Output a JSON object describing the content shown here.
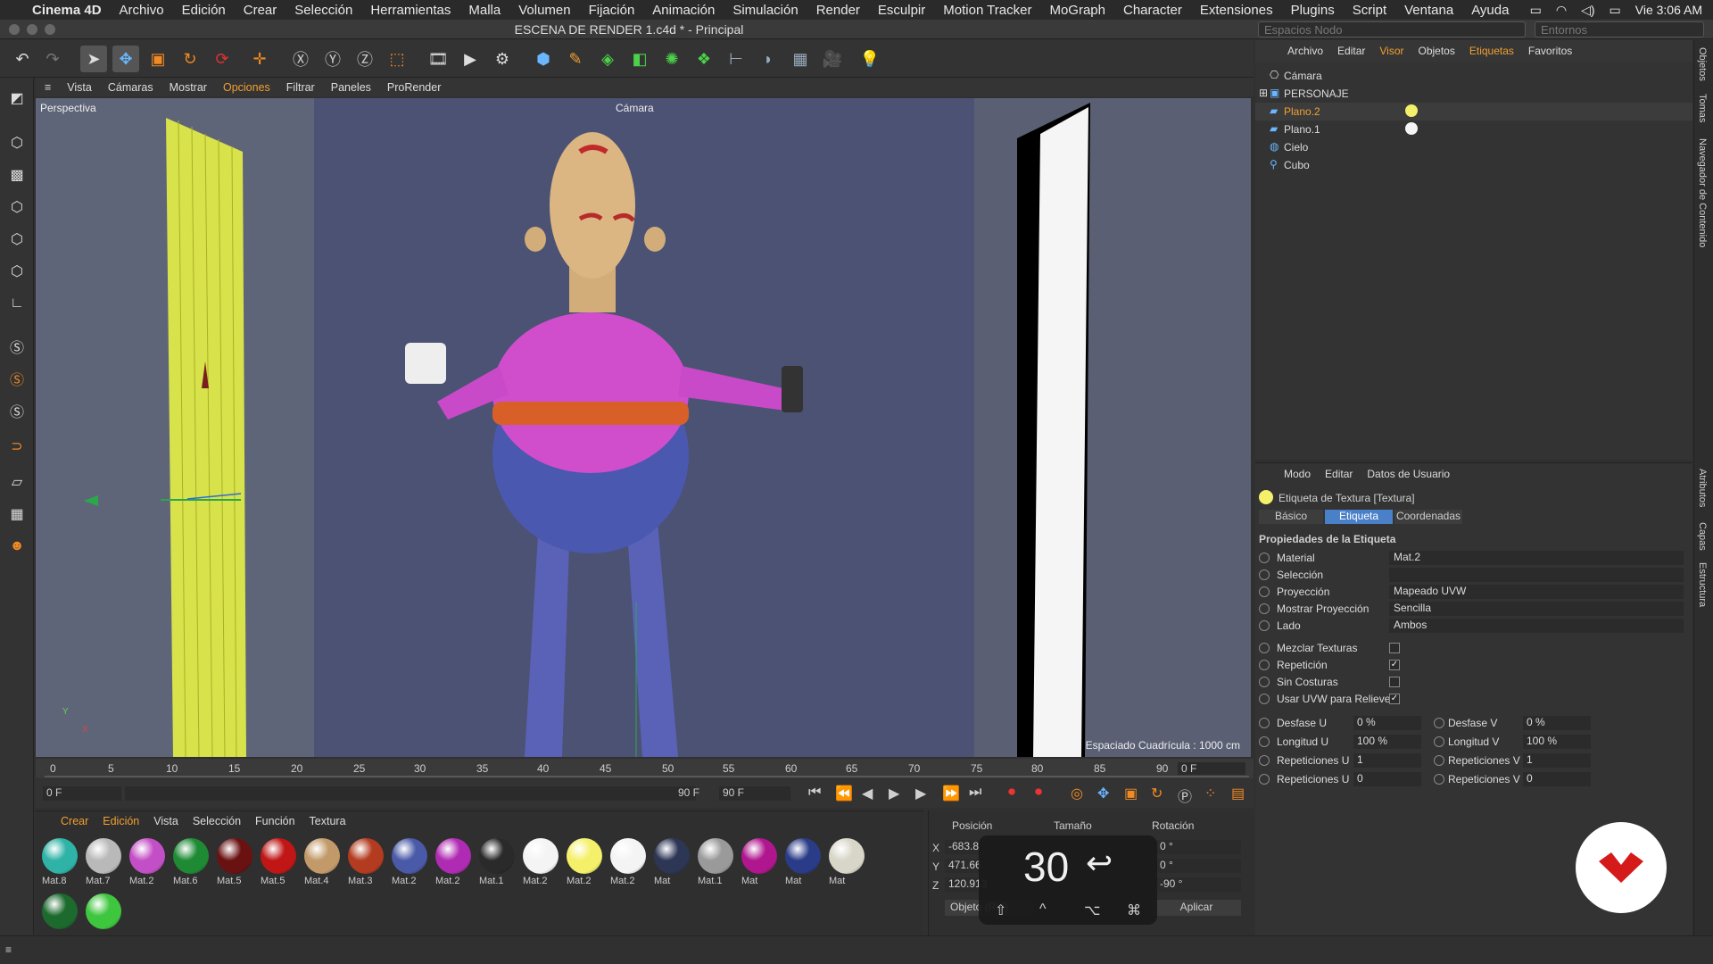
{
  "macmenu": {
    "app": "Cinema 4D",
    "items": [
      "Archivo",
      "Edición",
      "Crear",
      "Selección",
      "Herramientas",
      "Malla",
      "Volumen",
      "Fijación",
      "Animación",
      "Simulación",
      "Render",
      "Esculpir",
      "Motion Tracker",
      "MoGraph",
      "Character",
      "Extensiones",
      "Plugins",
      "Script",
      "Ventana",
      "Ayuda"
    ],
    "clock": "Vie 3:06 AM"
  },
  "window": {
    "title": "ESCENA DE RENDER 1.c4d * - Principal",
    "layout_select": "Espacios Nodo",
    "env_select": "Entornos"
  },
  "viewport_menu": [
    "Vista",
    "Cámaras",
    "Mostrar",
    "Opciones",
    "Filtrar",
    "Paneles",
    "ProRender"
  ],
  "viewport": {
    "label": "Perspectiva",
    "camera": "Cámara",
    "grid": "Espaciado Cuadrícula : 1000 cm"
  },
  "timeline": {
    "ticks": [
      "0",
      "5",
      "10",
      "15",
      "20",
      "25",
      "30",
      "35",
      "40",
      "45",
      "50",
      "55",
      "60",
      "65",
      "70",
      "75",
      "80",
      "85",
      "90"
    ],
    "frame_end_field": "0 F",
    "start": "0 F",
    "range_start": "0 F",
    "range_end": "90 F",
    "end": "90 F"
  },
  "mat_menu": [
    "Crear",
    "Edición",
    "Vista",
    "Selección",
    "Función",
    "Textura"
  ],
  "materials": [
    {
      "name": "Mat.8",
      "color": "#2fb3a6"
    },
    {
      "name": "Mat.7",
      "color": "#b9b9b9"
    },
    {
      "name": "Mat.2",
      "color": "#c34fc6"
    },
    {
      "name": "Mat.6",
      "color": "#1f8a34"
    },
    {
      "name": "Mat.5",
      "color": "#6a1212"
    },
    {
      "name": "Mat.5",
      "color": "#c01616"
    },
    {
      "name": "Mat.4",
      "color": "#c29a6a"
    },
    {
      "name": "Mat.3",
      "color": "#b33b20"
    },
    {
      "name": "Mat.2",
      "color": "#4a5aa8"
    },
    {
      "name": "Mat.2",
      "color": "#b02bb3"
    },
    {
      "name": "Mat.1",
      "color": "#2a2a2a"
    },
    {
      "name": "Mat.2",
      "color": "#f4f4f4"
    },
    {
      "name": "Mat.2",
      "color": "#f5f06a"
    },
    {
      "name": "Mat.2",
      "color": "#f4f4f4"
    },
    {
      "name": "Mat",
      "color": "#2e3656"
    },
    {
      "name": "Mat.1",
      "color": "#9a9a9a"
    },
    {
      "name": "Mat",
      "color": "#b0168e"
    },
    {
      "name": "Mat",
      "color": "#2a3c88"
    },
    {
      "name": "Mat",
      "color": "#d8d6c8"
    },
    {
      "name": "",
      "color": "#1c6a2e"
    },
    {
      "name": "",
      "color": "#3ec63e"
    }
  ],
  "coords": {
    "headers": [
      "Posición",
      "Tamaño",
      "Rotación"
    ],
    "x": "-683.8",
    "y": "471.66",
    "z": "120.913",
    "h": "0 °",
    "p": "0 °",
    "b": "-90 °",
    "mode": "Objeto (Rel)",
    "apply": "Aplicar"
  },
  "obj_menu": [
    "Archivo",
    "Editar",
    "Visor",
    "Objetos",
    "Etiquetas",
    "Favoritos"
  ],
  "objects": [
    {
      "name": "Cámara"
    },
    {
      "name": "PERSONAJE"
    },
    {
      "name": "Plano.2"
    },
    {
      "name": "Plano.1"
    },
    {
      "name": "Cielo"
    },
    {
      "name": "Cubo"
    }
  ],
  "attr_menu": [
    "Modo",
    "Editar",
    "Datos de Usuario"
  ],
  "attr": {
    "header": "Etiqueta de Textura [Textura]",
    "tabs": [
      "Básico",
      "Etiqueta",
      "Coordenadas"
    ],
    "section": "Propiedades de la Etiqueta",
    "rows": [
      {
        "name": "Material",
        "val": "Mat.2"
      },
      {
        "name": "Selección",
        "val": ""
      },
      {
        "name": "Proyección",
        "val": "Mapeado UVW"
      },
      {
        "name": "Mostrar Proyección",
        "val": "Sencilla"
      },
      {
        "name": "Lado",
        "val": "Ambos"
      }
    ],
    "checks": [
      {
        "name": "Mezclar Texturas",
        "on": ""
      },
      {
        "name": "Repetición",
        "on": "✓"
      },
      {
        "name": "Sin Costuras",
        "on": ""
      },
      {
        "name": "Usar UVW para Relieve",
        "on": "✓"
      }
    ],
    "pairs": [
      {
        "a": "Desfase U",
        "av": "0 %",
        "b": "Desfase V",
        "bv": "0 %"
      },
      {
        "a": "Longitud U",
        "av": "100 %",
        "b": "Longitud V",
        "bv": "100 %"
      },
      {
        "a": "Repeticiones U",
        "av": "1",
        "b": "Repeticiones V",
        "bv": "1"
      },
      {
        "a": "Repeticiones U",
        "av": "0",
        "b": "Repeticiones V",
        "bv": "0"
      }
    ]
  },
  "side_tabs": [
    "Objetos",
    "Tomas",
    "Navegador de Contenido",
    "Atributos",
    "Capas",
    "Estructura"
  ],
  "kbd": {
    "big": "30",
    "keys": [
      "⇧",
      "^",
      "⌥",
      "⌘"
    ]
  }
}
